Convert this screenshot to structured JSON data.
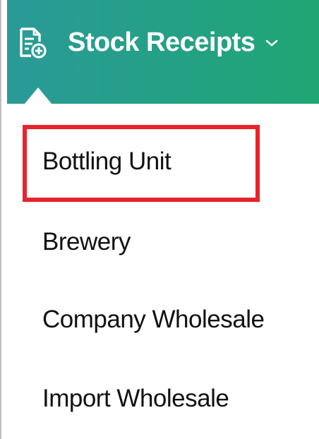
{
  "header": {
    "title": "Stock Receipts",
    "icon": "document-add-icon",
    "chevron": "chevron-down-icon",
    "background_start": "#2a9a98",
    "background_end": "#1fa674"
  },
  "menu": {
    "items": [
      {
        "label": "Bottling Unit",
        "highlighted": true
      },
      {
        "label": "Brewery"
      },
      {
        "label": "Company Wholesale"
      },
      {
        "label": "Import Wholesale"
      }
    ]
  },
  "highlight_color": "#e8232b"
}
